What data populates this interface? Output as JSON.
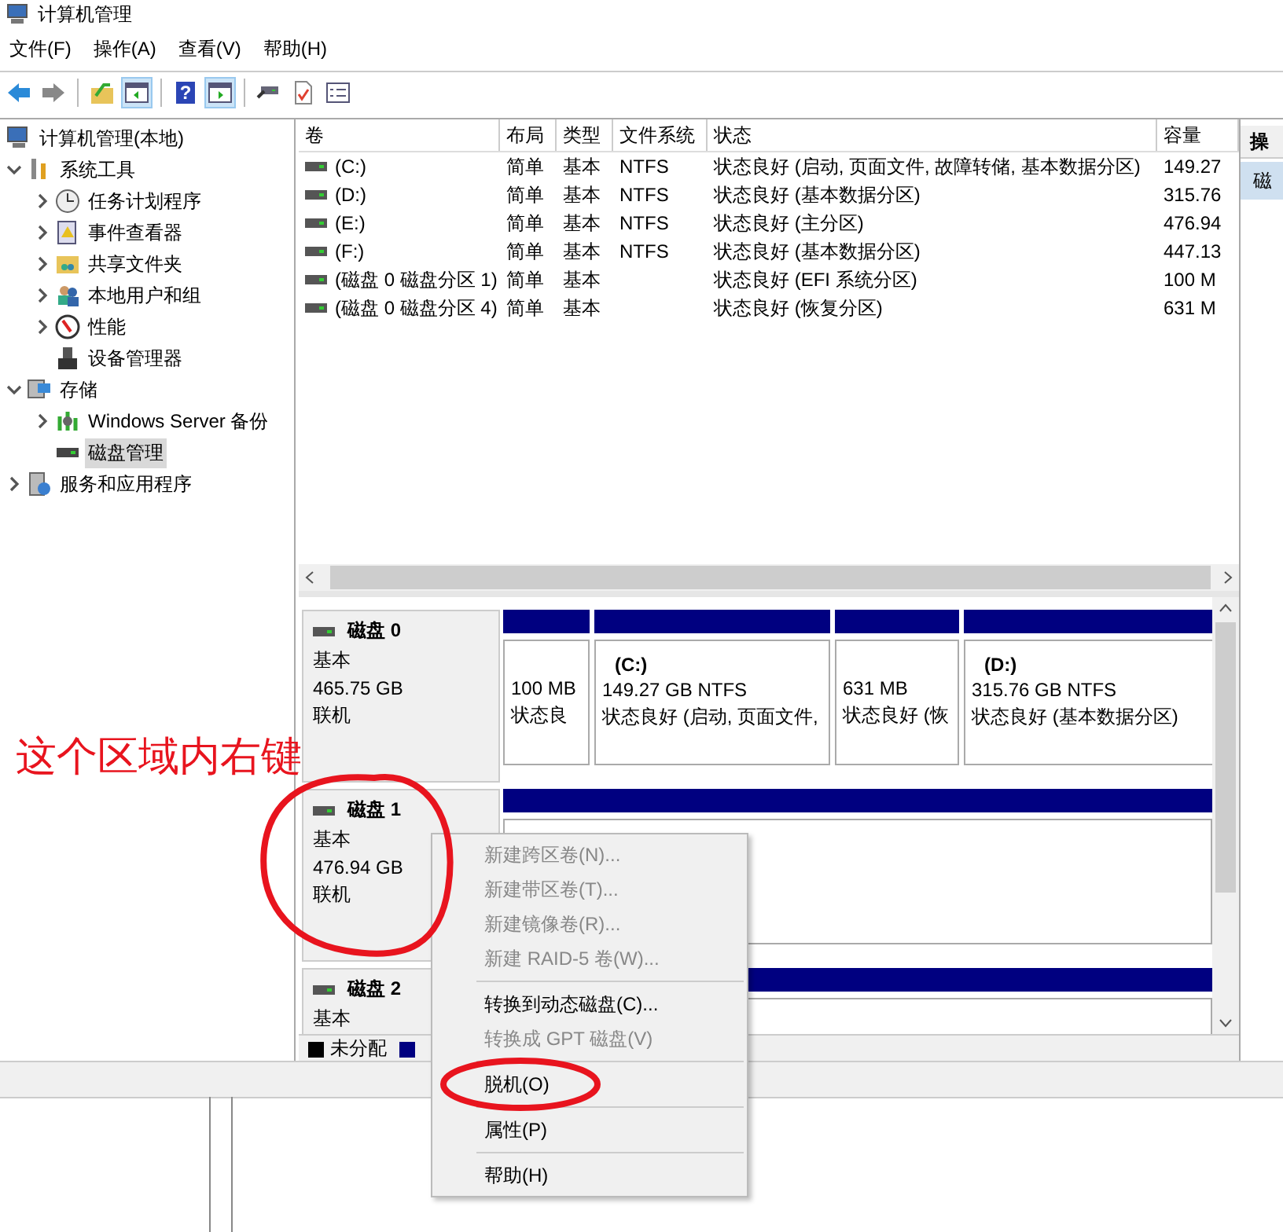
{
  "window": {
    "title": "计算机管理"
  },
  "menu_bar": [
    "文件(F)",
    "操作(A)",
    "查看(V)",
    "帮助(H)"
  ],
  "toolbar": [
    {
      "pressed": false
    },
    {
      "pressed": false
    },
    {
      "pressed": false
    },
    {
      "pressed": true
    },
    {
      "pressed": false,
      "label": "?"
    },
    {
      "pressed": true
    },
    {
      "pressed": false
    },
    {
      "pressed": false
    },
    {
      "pressed": false
    }
  ],
  "tree": [
    {
      "label": "计算机管理(本地)",
      "kind": "root",
      "selected": false,
      "children": [
        {
          "label": "系统工具",
          "kind": "branch",
          "expanded": true,
          "selected": false,
          "children": [
            {
              "label": "任务计划程序",
              "kind": "branch",
              "expanded": false,
              "selected": false
            },
            {
              "label": "事件查看器",
              "kind": "branch",
              "expanded": false,
              "selected": false
            },
            {
              "label": "共享文件夹",
              "kind": "branch",
              "expanded": false,
              "selected": false
            },
            {
              "label": "本地用户和组",
              "kind": "branch",
              "expanded": false,
              "selected": false
            },
            {
              "label": "性能",
              "kind": "branch",
              "expanded": false,
              "selected": false
            },
            {
              "label": "设备管理器",
              "kind": "leaf",
              "selected": false
            }
          ]
        },
        {
          "label": "存储",
          "kind": "branch",
          "expanded": true,
          "selected": false,
          "children": [
            {
              "label": "Windows Server 备份",
              "kind": "branch",
              "expanded": false,
              "selected": false
            },
            {
              "label": "磁盘管理",
              "kind": "leaf",
              "selected": true
            }
          ]
        },
        {
          "label": "服务和应用程序",
          "kind": "branch",
          "expanded": false,
          "selected": false
        }
      ]
    }
  ],
  "table": {
    "columns": [
      "卷",
      "布局",
      "类型",
      "文件系统",
      "状态",
      "容量"
    ],
    "rows": [
      [
        "(C:)",
        "简单",
        "基本",
        "NTFS",
        "状态良好 (启动, 页面文件, 故障转储, 基本数据分区)",
        "149.27"
      ],
      [
        "(D:)",
        "简单",
        "基本",
        "NTFS",
        "状态良好 (基本数据分区)",
        "315.76"
      ],
      [
        "(E:)",
        "简单",
        "基本",
        "NTFS",
        "状态良好 (主分区)",
        "476.94"
      ],
      [
        "(F:)",
        "简单",
        "基本",
        "NTFS",
        "状态良好 (基本数据分区)",
        "447.13"
      ],
      [
        "(磁盘 0 磁盘分区 1)",
        "简单",
        "基本",
        "",
        "状态良好 (EFI 系统分区)",
        "100 M"
      ],
      [
        "(磁盘 0 磁盘分区 4)",
        "简单",
        "基本",
        "",
        "状态良好 (恢复分区)",
        "631 M"
      ]
    ]
  },
  "disks": [
    {
      "name": "磁盘 0",
      "type": "基本",
      "size": "465.75 GB",
      "status": "联机",
      "partitions": [
        {
          "size": "100 MB",
          "status": "状态良"
        },
        {
          "label": "(C:)",
          "size": "149.27 GB NTFS",
          "status": "状态良好 (启动, 页面文件,"
        },
        {
          "size": "631 MB",
          "status": "状态良好 (恢"
        },
        {
          "label": "(D:)",
          "size": "315.76 GB NTFS",
          "status": "状态良好 (基本数据分区)"
        }
      ]
    },
    {
      "name": "磁盘 1",
      "type": "基本",
      "size": "476.94 GB",
      "status": "联机"
    },
    {
      "name": "磁盘 2",
      "type": "基本"
    }
  ],
  "legend": [
    {
      "label": "未分配",
      "color": "#000000"
    },
    {
      "color": "#000080"
    }
  ],
  "actions_panel": {
    "title": "操",
    "item": "磁"
  },
  "annotation": {
    "text": "这个区域内右键"
  },
  "context_menu": [
    {
      "kind": "item",
      "label": "新建跨区卷(N)...",
      "disabled": true
    },
    {
      "kind": "item",
      "label": "新建带区卷(T)...",
      "disabled": true
    },
    {
      "kind": "item",
      "label": "新建镜像卷(R)...",
      "disabled": true
    },
    {
      "kind": "item",
      "label": "新建 RAID-5 卷(W)...",
      "disabled": true
    },
    {
      "kind": "separator"
    },
    {
      "kind": "item",
      "label": "转换到动态磁盘(C)...",
      "disabled": false
    },
    {
      "kind": "item",
      "label": "转换成 GPT 磁盘(V)",
      "disabled": true
    },
    {
      "kind": "separator"
    },
    {
      "kind": "item",
      "label": "脱机(O)",
      "disabled": false
    },
    {
      "kind": "separator"
    },
    {
      "kind": "item",
      "label": "属性(P)",
      "disabled": false
    },
    {
      "kind": "separator"
    },
    {
      "kind": "item",
      "label": "帮助(H)",
      "disabled": false
    }
  ]
}
